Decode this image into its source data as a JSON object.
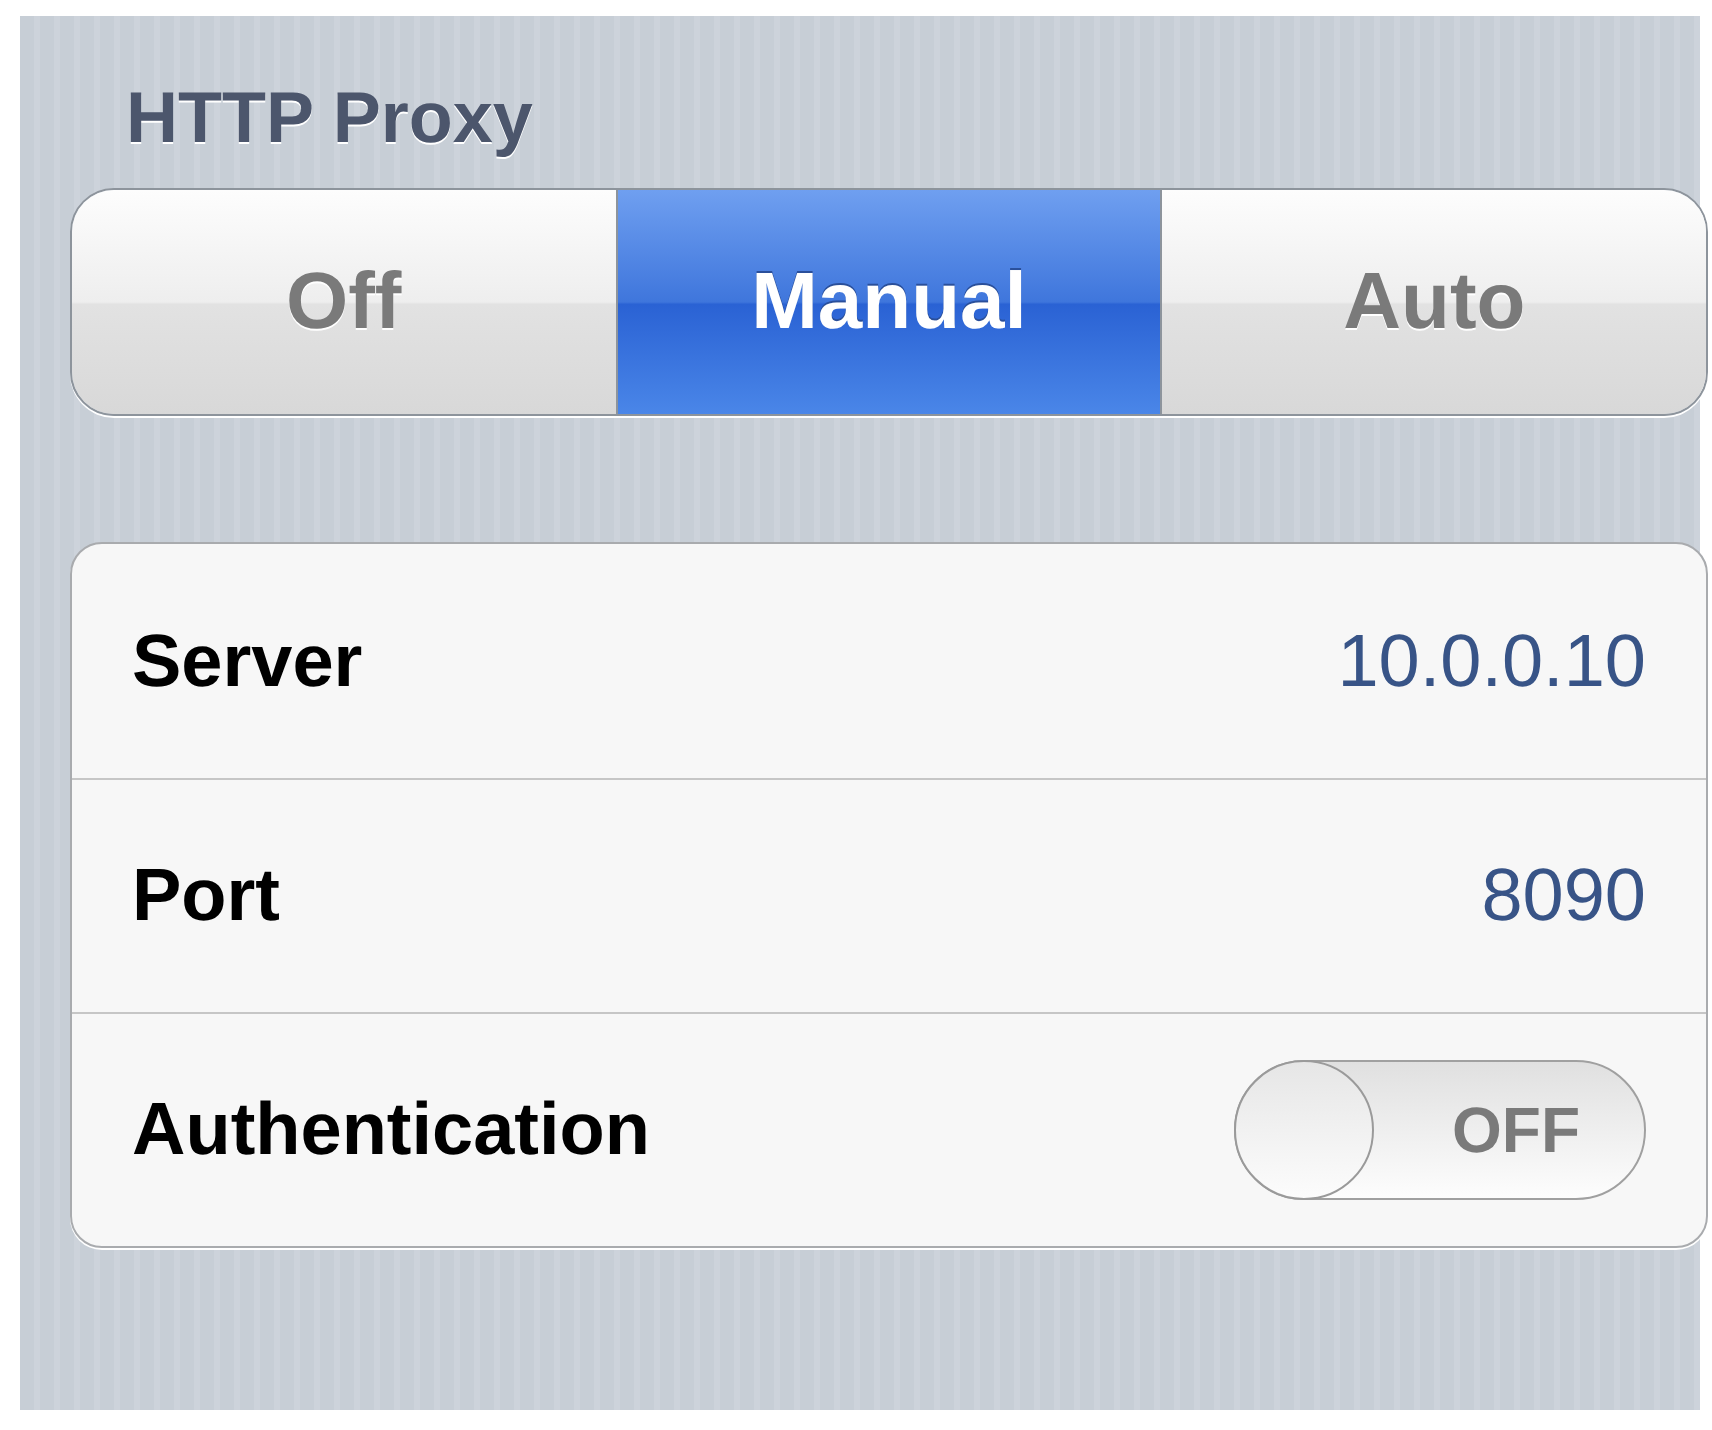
{
  "section_title": "HTTP Proxy",
  "segments": [
    {
      "label": "Off",
      "selected": false
    },
    {
      "label": "Manual",
      "selected": true
    },
    {
      "label": "Auto",
      "selected": false
    }
  ],
  "rows": [
    {
      "kind": "value",
      "label": "Server",
      "value": "10.0.0.10"
    },
    {
      "kind": "value",
      "label": "Port",
      "value": "8090"
    },
    {
      "kind": "toggle",
      "label": "Authentication",
      "on": false,
      "toggle_text": "OFF"
    }
  ]
}
